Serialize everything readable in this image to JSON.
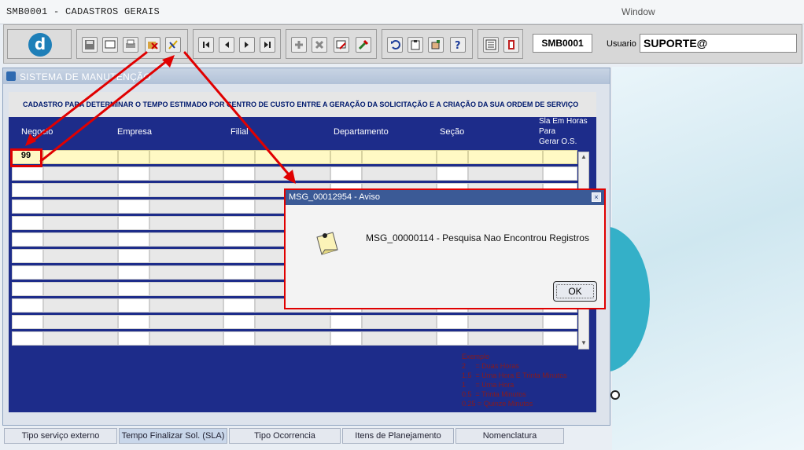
{
  "window": {
    "title": "SMB0001 - CADASTROS GERAIS",
    "menu_window": "Window"
  },
  "toolbar": {
    "logo_letter": "d",
    "form_code": "SMB0001",
    "user_label": "Usuario",
    "user_value": "SUPORTE@",
    "buttons": [
      "save-icon",
      "screen-icon",
      "print-icon",
      "clear-icon",
      "execute-query-icon",
      "first-record-icon",
      "previous-record-icon",
      "next-record-icon",
      "last-record-icon",
      "insert-icon",
      "delete-icon",
      "edit-icon",
      "paint-icon",
      "undo-icon",
      "clipboard-icon",
      "hand-icon",
      "help-icon",
      "menu-icon",
      "exit-icon"
    ]
  },
  "form": {
    "window_title": "SISTEMA DE MANUTENÇÃO",
    "caption": "CADASTRO PARA DETERMINAR O TEMPO ESTIMADO POR CENTRO DE CUSTO ENTRE A GERAÇÃO DA SOLICITAÇÃO E A CRIAÇÃO DA SUA ORDEM DE SERVIÇO",
    "columns": {
      "negocio": "Negocio",
      "empresa": "Empresa",
      "filial": "Filial",
      "departamento": "Departamento",
      "secao": "Seção",
      "sla_line1": "Sla Em Horas",
      "sla_line2": "Para",
      "sla_line3": "Gerar O.S."
    },
    "first_row_negocio": "99",
    "example": {
      "title": "Exemplo",
      "lines": [
        "2     = Duas Horas",
        "1.5  = Uma Hora E Trinta Minutos",
        "1     = Uma Hora",
        "0.5  = Trinta Minutos",
        "0.25 = Quinze Minutos"
      ]
    }
  },
  "tabs": [
    {
      "label": "Tipo serviço externo"
    },
    {
      "label": "Tempo Finalizar Sol. (SLA)"
    },
    {
      "label": "Tipo Ocorrencia"
    },
    {
      "label": "Itens de Planejamento"
    },
    {
      "label": "Nomenclatura"
    }
  ],
  "dialog": {
    "title": "MSG_00012954 - Aviso",
    "close": "×",
    "message": "MSG_00000114 - Pesquisa Nao Encontrou Registros",
    "ok_label": "OK"
  },
  "colors": {
    "annotation": "#e00000",
    "grid_header": "#1d2c8a",
    "accent_teal": "#34b0c8"
  }
}
